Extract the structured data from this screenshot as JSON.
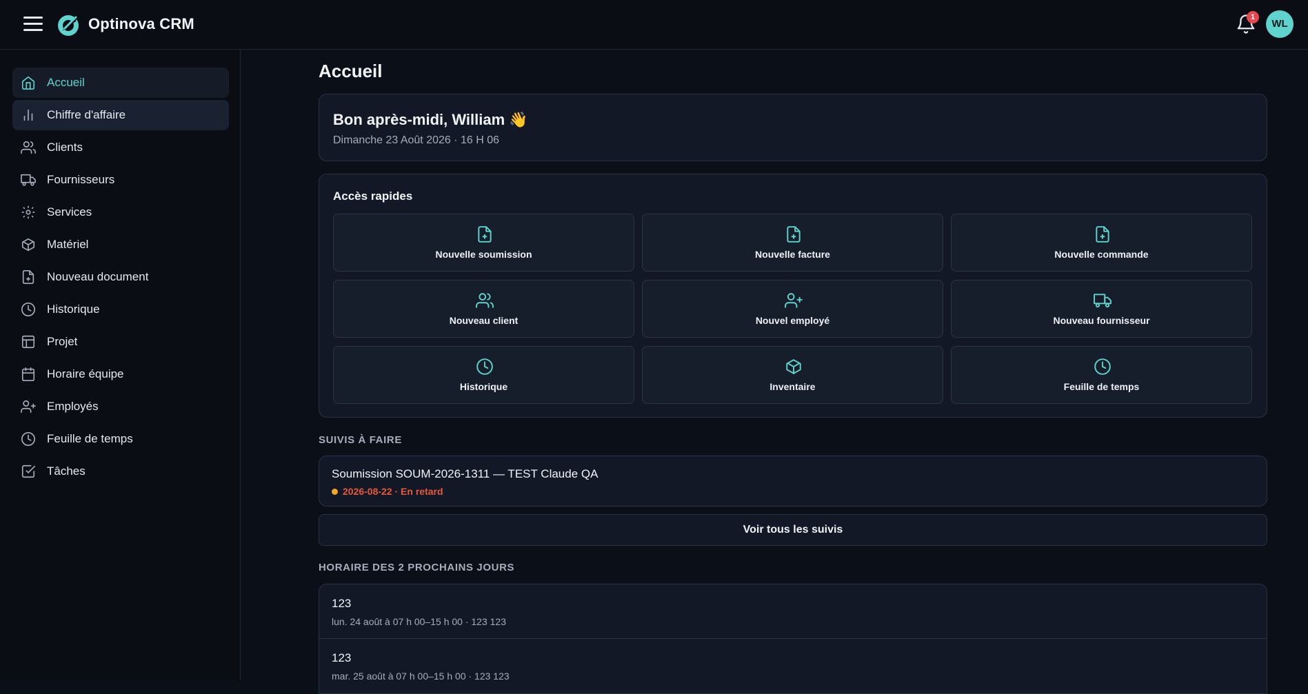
{
  "app": {
    "brand": "Optinova CRM",
    "notification_count": "1",
    "avatar_initials": "WL"
  },
  "colors": {
    "accent": "#5fd3cd",
    "background": "#0b0f17",
    "card": "#121826",
    "danger": "#e8593b",
    "warning": "#f5a623"
  },
  "sidebar": {
    "items": [
      {
        "label": "Accueil",
        "icon": "home-icon",
        "active": true
      },
      {
        "label": "Chiffre d'affaire",
        "icon": "bar-chart-icon",
        "hover": true
      },
      {
        "label": "Clients",
        "icon": "users-icon"
      },
      {
        "label": "Fournisseurs",
        "icon": "truck-icon"
      },
      {
        "label": "Services",
        "icon": "gear-icon"
      },
      {
        "label": "Matériel",
        "icon": "box-icon"
      },
      {
        "label": "Nouveau document",
        "icon": "file-plus-icon"
      },
      {
        "label": "Historique",
        "icon": "clock-icon"
      },
      {
        "label": "Projet",
        "icon": "layout-icon"
      },
      {
        "label": "Horaire équipe",
        "icon": "calendar-icon"
      },
      {
        "label": "Employés",
        "icon": "user-plus-icon"
      },
      {
        "label": "Feuille de temps",
        "icon": "clock-icon"
      },
      {
        "label": "Tâches",
        "icon": "check-square-icon"
      }
    ]
  },
  "main": {
    "page_title": "Accueil",
    "greeting": {
      "title": "Bon après-midi, William 👋",
      "subtitle": "Dimanche 23 Août 2026 · 16 H 06"
    },
    "quick_access": {
      "title": "Accès rapides",
      "tiles": [
        {
          "label": "Nouvelle soumission",
          "icon": "file-plus-icon"
        },
        {
          "label": "Nouvelle facture",
          "icon": "file-plus-icon"
        },
        {
          "label": "Nouvelle commande",
          "icon": "file-plus-icon"
        },
        {
          "label": "Nouveau client",
          "icon": "users-icon"
        },
        {
          "label": "Nouvel employé",
          "icon": "user-plus-icon"
        },
        {
          "label": "Nouveau fournisseur",
          "icon": "truck-icon"
        },
        {
          "label": "Historique",
          "icon": "clock-icon"
        },
        {
          "label": "Inventaire",
          "icon": "box-icon"
        },
        {
          "label": "Feuille de temps",
          "icon": "clock-icon"
        }
      ]
    },
    "followups": {
      "section_label": "SUIVIS À FAIRE",
      "items": [
        {
          "title": "Soumission SOUM-2026-1311 — TEST Claude QA",
          "meta": "2026-08-22 · En retard"
        }
      ],
      "view_all_label": "Voir tous les suivis"
    },
    "schedule": {
      "section_label": "HORAIRE DES 2 PROCHAINS JOURS",
      "items": [
        {
          "title": "123",
          "subtitle": "lun. 24 août à 07 h 00–15 h 00 · 123 123"
        },
        {
          "title": "123",
          "subtitle": "mar. 25 août à 07 h 00–15 h 00 · 123 123"
        }
      ]
    }
  }
}
